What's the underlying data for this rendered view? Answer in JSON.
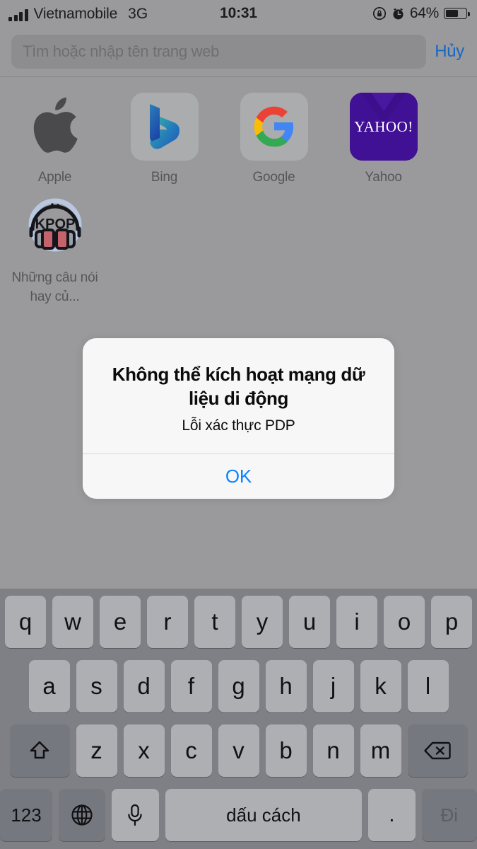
{
  "status_bar": {
    "carrier": "Vietnamobile",
    "network_type": "3G",
    "time": "10:31",
    "battery_percent": "64%",
    "battery_level": 64,
    "icons": [
      "signal-bars-icon",
      "rotation-lock-icon",
      "alarm-clock-icon",
      "battery-icon"
    ]
  },
  "browser": {
    "search": {
      "placeholder": "Tìm hoặc nhập tên trang web",
      "value": ""
    },
    "cancel_label": "Hủy",
    "favorites": [
      {
        "label": "Apple",
        "icon": "apple-logo-icon",
        "tile": "plain"
      },
      {
        "label": "Bing",
        "icon": "bing-logo-icon",
        "tile": "light"
      },
      {
        "label": "Google",
        "icon": "google-logo-icon",
        "tile": "light"
      },
      {
        "label": "Yahoo",
        "icon": "yahoo-logo-icon",
        "tile": "purple"
      },
      {
        "label": "Những câu nói hay củ...",
        "icon": "kpop-headphones-icon",
        "tile": "plain"
      }
    ]
  },
  "alert": {
    "title": "Không thể kích hoạt mạng dữ liệu di động",
    "message": "Lỗi xác thực PDP",
    "ok_label": "OK",
    "ok_color": "#0a84ff"
  },
  "keyboard": {
    "row1": [
      "q",
      "w",
      "e",
      "r",
      "t",
      "y",
      "u",
      "i",
      "o",
      "p"
    ],
    "row2": [
      "a",
      "s",
      "d",
      "f",
      "g",
      "h",
      "j",
      "k",
      "l"
    ],
    "row3": [
      "z",
      "x",
      "c",
      "v",
      "b",
      "n",
      "m"
    ],
    "shift_key": "shift-icon",
    "backspace_key": "backspace-icon",
    "numbers_key": "123",
    "globe_key": "globe-icon",
    "dictation_key": "microphone-icon",
    "space_key": "dấu cách",
    "period_key": ".",
    "go_key": "Đi"
  },
  "colors": {
    "accent_blue": "#0a84ff",
    "cancel_blue": "#1666c4",
    "dim_overlay": "#9a9a9c",
    "keyboard_bg": "#7f8086",
    "key_bg": "#aeafb2",
    "key_dark_bg": "#767880"
  }
}
